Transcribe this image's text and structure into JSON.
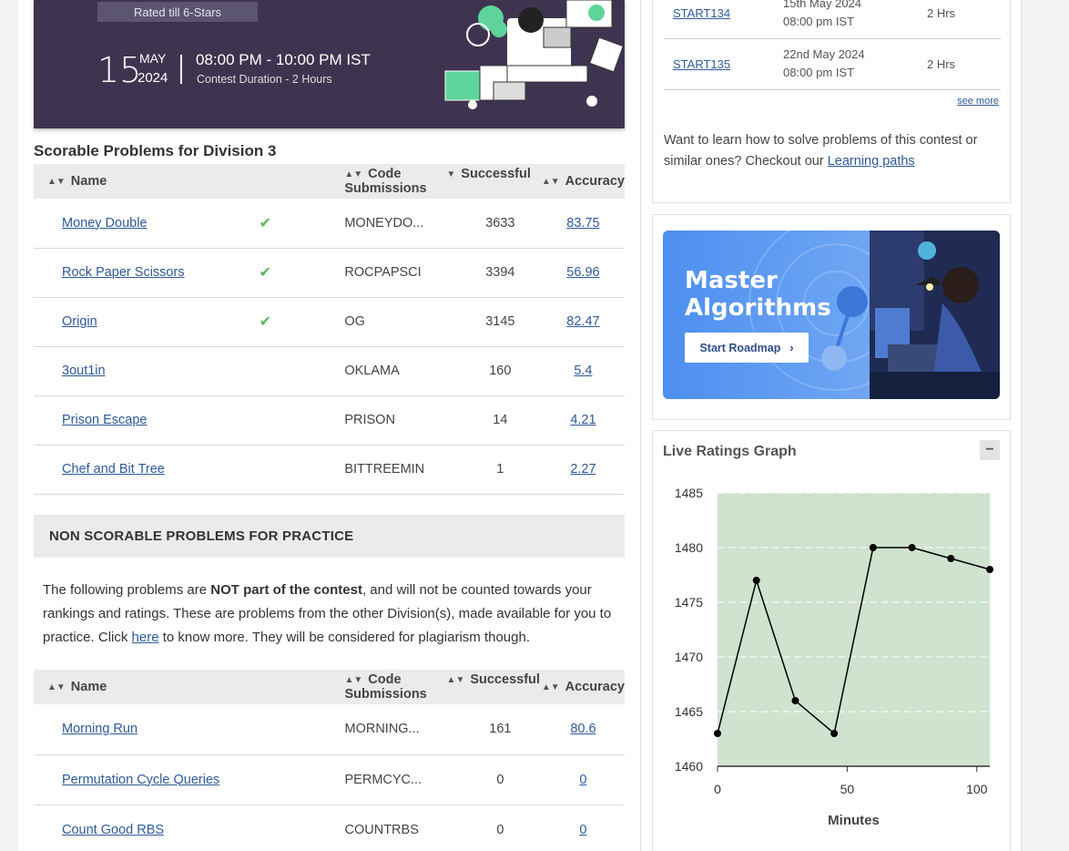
{
  "banner": {
    "rated": "Rated till 6-Stars",
    "day": "15",
    "month": "MAY",
    "year": "2024",
    "time": "08:00 PM - 10:00 PM IST",
    "duration": "Contest Duration - 2  Hours"
  },
  "scorable": {
    "title": "Scorable Problems for Division 3",
    "headers": {
      "name": "Name",
      "code": "Code",
      "submissions": "Successful Submissions",
      "accuracy": "Accuracy"
    },
    "rows": [
      {
        "name": "Money Double",
        "solved": true,
        "code": "MONEYDO...",
        "submissions": "3633",
        "accuracy": "83.75"
      },
      {
        "name": "Rock Paper Scissors",
        "solved": true,
        "code": "ROCPAPSCI",
        "submissions": "3394",
        "accuracy": "56.96"
      },
      {
        "name": "Origin",
        "solved": true,
        "code": "OG",
        "submissions": "3145",
        "accuracy": "82.47"
      },
      {
        "name": "3out1in",
        "solved": false,
        "code": "OKLAMA",
        "submissions": "160",
        "accuracy": "5.4"
      },
      {
        "name": "Prison Escape",
        "solved": false,
        "code": "PRISON",
        "submissions": "14",
        "accuracy": "4.21"
      },
      {
        "name": "Chef and Bit Tree",
        "solved": false,
        "code": "BITTREEMIN",
        "submissions": "1",
        "accuracy": "2.27"
      }
    ]
  },
  "nonscorable": {
    "heading": "NON SCORABLE PROBLEMS FOR PRACTICE",
    "text_before": "The following problems are ",
    "text_bold": "NOT part of the contest",
    "text_middle": ", and will not be counted towards your rankings and ratings. These are problems from the other Division(s), made available for you to practice. Click ",
    "text_link": "here",
    "text_after": " to know more. They will be considered for plagiarism though.",
    "headers": {
      "name": "Name",
      "code": "Code",
      "submissions": "Successful Submissions",
      "accuracy": "Accuracy"
    },
    "rows": [
      {
        "name": "Morning Run",
        "code": "MORNING...",
        "submissions": "161",
        "accuracy": "80.6"
      },
      {
        "name": "Permutation Cycle Queries",
        "code": "PERMCYC...",
        "submissions": "0",
        "accuracy": "0"
      },
      {
        "name": "Count Good RBS",
        "code": "COUNTRBS",
        "submissions": "0",
        "accuracy": "0"
      }
    ]
  },
  "upcoming": {
    "rows": [
      {
        "code": "START134",
        "date": "15th May 2024",
        "time": "08:00 pm IST",
        "duration": "2 Hrs"
      },
      {
        "code": "START135",
        "date": "22nd May 2024",
        "time": "08:00 pm IST",
        "duration": "2 Hrs"
      }
    ],
    "see_more": "see more",
    "learn_text": "Want to learn how to solve problems of this contest or similar ones? Checkout our ",
    "learn_link": "Learning paths"
  },
  "ad": {
    "title_line1": "Master",
    "title_line2": "Algorithms",
    "button": "Start Roadmap"
  },
  "graph": {
    "title": "Live Ratings Graph",
    "collapse": "−",
    "colors": {
      "fill": "#cfe3cf",
      "line": "#000000",
      "grid": "#ffffff"
    }
  },
  "chart_data": {
    "type": "line",
    "title": "Live Ratings Graph",
    "xlabel": "Minutes",
    "ylabel": "",
    "x": [
      0,
      15,
      30,
      45,
      60,
      75,
      90,
      105
    ],
    "series": [
      {
        "values": [
          1463,
          1477,
          1466,
          1463,
          1480,
          1480,
          1479,
          1478
        ]
      }
    ],
    "xlim": [
      0,
      105
    ],
    "ylim": [
      1460,
      1485
    ],
    "xticks": [
      0,
      50,
      100
    ],
    "yticks": [
      1460,
      1465,
      1470,
      1475,
      1480,
      1485
    ],
    "grid": true
  }
}
